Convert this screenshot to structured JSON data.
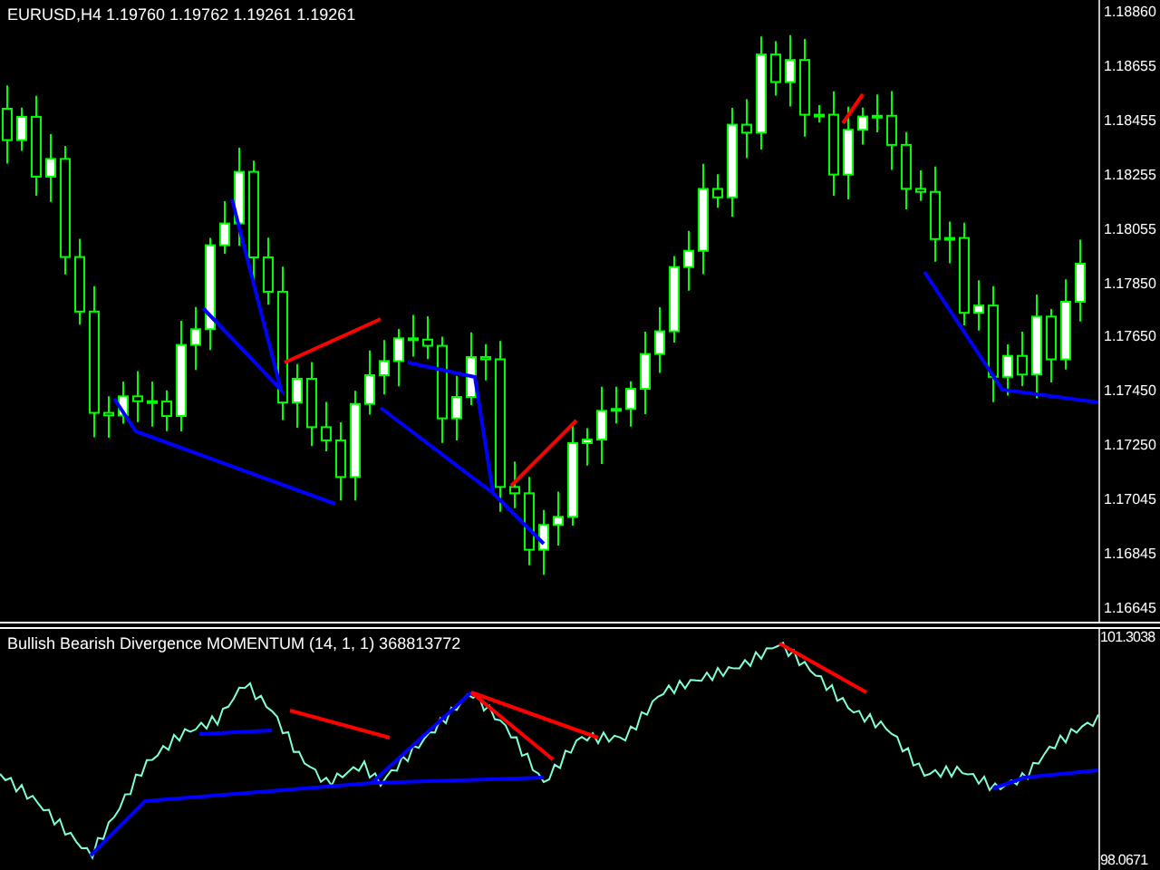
{
  "price_chart": {
    "header": "EURUSD,H4  1.19760 1.19762 1.19261 1.19261",
    "price_axis": [
      "1.18860",
      "1.18655",
      "1.18455",
      "1.18255",
      "1.18055",
      "1.17850",
      "1.17650",
      "1.17450",
      "1.17250",
      "1.17045",
      "1.16845",
      "1.16645"
    ]
  },
  "indicator": {
    "title": "Bullish Bearish Divergence MOMENTUM (14, 1, 1) 368813772",
    "value_axis": [
      "101.3038",
      "98.0671"
    ]
  }
}
